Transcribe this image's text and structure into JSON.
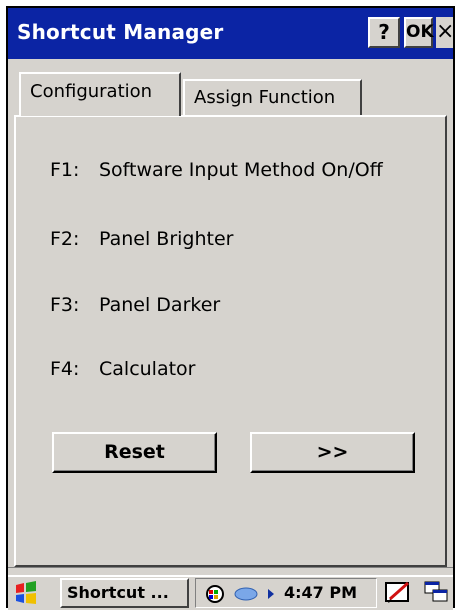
{
  "window": {
    "title": "Shortcut Manager",
    "help_label": "?",
    "ok_label": "OK",
    "close_label": "×"
  },
  "tabs": [
    {
      "label": "Configuration",
      "active": true
    },
    {
      "label": "Assign Function",
      "active": false
    }
  ],
  "functions": [
    {
      "key": "F1:",
      "action": "Software Input Method On/Off"
    },
    {
      "key": "F2:",
      "action": "Panel Brighter"
    },
    {
      "key": "F3:",
      "action": "Panel Darker"
    },
    {
      "key": "F4:",
      "action": "Calculator"
    }
  ],
  "buttons": {
    "reset_label": "Reset",
    "next_label": ">>"
  },
  "taskbar": {
    "task_label": "Shortcut ...",
    "time": "4:47 PM",
    "icons": [
      "windows-start-icon",
      "network-icon",
      "connection-icon",
      "sip-keyboard-icon",
      "switch-window-icon"
    ]
  },
  "colors": {
    "titlebar": "#0b24a4",
    "face": "#d6d3ce"
  }
}
